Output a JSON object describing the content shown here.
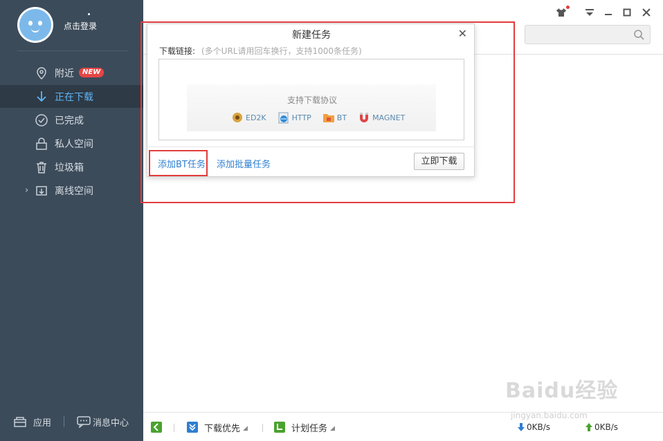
{
  "sidebar": {
    "login_label": "点击登录",
    "items": [
      {
        "label": "附近",
        "badge": "NEW"
      },
      {
        "label": "正在下载"
      },
      {
        "label": "已完成"
      },
      {
        "label": "私人空间"
      },
      {
        "label": "垃圾箱"
      },
      {
        "label": "离线空间"
      }
    ],
    "bottom": {
      "apps": "应用",
      "messages": "消息中心"
    }
  },
  "dialog": {
    "title": "新建任务",
    "url_label": "下载链接:",
    "url_hint": "(多个URL请用回车换行，支持1000条任务)",
    "protocol_title": "支持下载协议",
    "protocols": [
      "ED2K",
      "HTTP",
      "BT",
      "MAGNET"
    ],
    "add_bt": "添加BT任务",
    "add_batch": "添加批量任务",
    "download_now": "立即下载"
  },
  "statusbar": {
    "priority": "下载优先",
    "schedule": "计划任务",
    "down_speed": "0KB/s",
    "up_speed": "0KB/s"
  },
  "watermark": {
    "brand": "Baidu经验",
    "url": "jingyan.baidu.com"
  },
  "colors": {
    "sidebar": "#3c4b5a",
    "active": "#2e3a46",
    "link": "#2e7fd1",
    "annotation": "#e23c3c"
  }
}
